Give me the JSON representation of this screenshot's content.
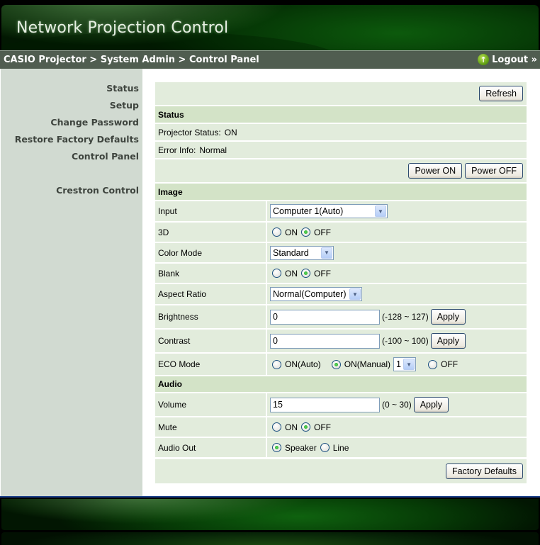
{
  "header": {
    "app_title": "Network Projection Control"
  },
  "breadcrumb": {
    "path": "CASIO Projector > System Admin > Control Panel",
    "logout_label": "Logout »"
  },
  "sidebar": {
    "items": [
      {
        "label": "Status"
      },
      {
        "label": "Setup"
      },
      {
        "label": "Change Password"
      },
      {
        "label": "Restore Factory Defaults"
      },
      {
        "label": "Control Panel"
      },
      {
        "label": "Crestron Control"
      }
    ]
  },
  "panel": {
    "refresh_label": "Refresh",
    "status_section": "Status",
    "projector_status_label": "Projector Status:",
    "projector_status_value": "ON",
    "error_info_label": "Error Info:",
    "error_info_value": "Normal",
    "power_on_label": "Power ON",
    "power_off_label": "Power OFF",
    "image_section": "Image",
    "input": {
      "label": "Input",
      "value": "Computer 1(Auto)"
    },
    "three_d": {
      "label": "3D",
      "options": [
        "ON",
        "OFF"
      ],
      "selected": "OFF"
    },
    "color_mode": {
      "label": "Color Mode",
      "value": "Standard"
    },
    "blank": {
      "label": "Blank",
      "options": [
        "ON",
        "OFF"
      ],
      "selected": "OFF"
    },
    "aspect_ratio": {
      "label": "Aspect Ratio",
      "value": "Normal(Computer)"
    },
    "brightness": {
      "label": "Brightness",
      "value": "0",
      "range": "(-128 ~ 127)",
      "apply_label": "Apply"
    },
    "contrast": {
      "label": "Contrast",
      "value": "0",
      "range": "(-100 ~ 100)",
      "apply_label": "Apply"
    },
    "eco_mode": {
      "label": "ECO Mode",
      "options": [
        "ON(Auto)",
        "ON(Manual)",
        "OFF"
      ],
      "selected": "ON(Manual)",
      "manual_level": "1"
    },
    "audio_section": "Audio",
    "volume": {
      "label": "Volume",
      "value": "15",
      "range": "(0 ~ 30)",
      "apply_label": "Apply"
    },
    "mute": {
      "label": "Mute",
      "options": [
        "ON",
        "OFF"
      ],
      "selected": "OFF"
    },
    "audio_out": {
      "label": "Audio Out",
      "options": [
        "Speaker",
        "Line"
      ],
      "selected": "Speaker"
    },
    "factory_defaults_label": "Factory Defaults"
  }
}
